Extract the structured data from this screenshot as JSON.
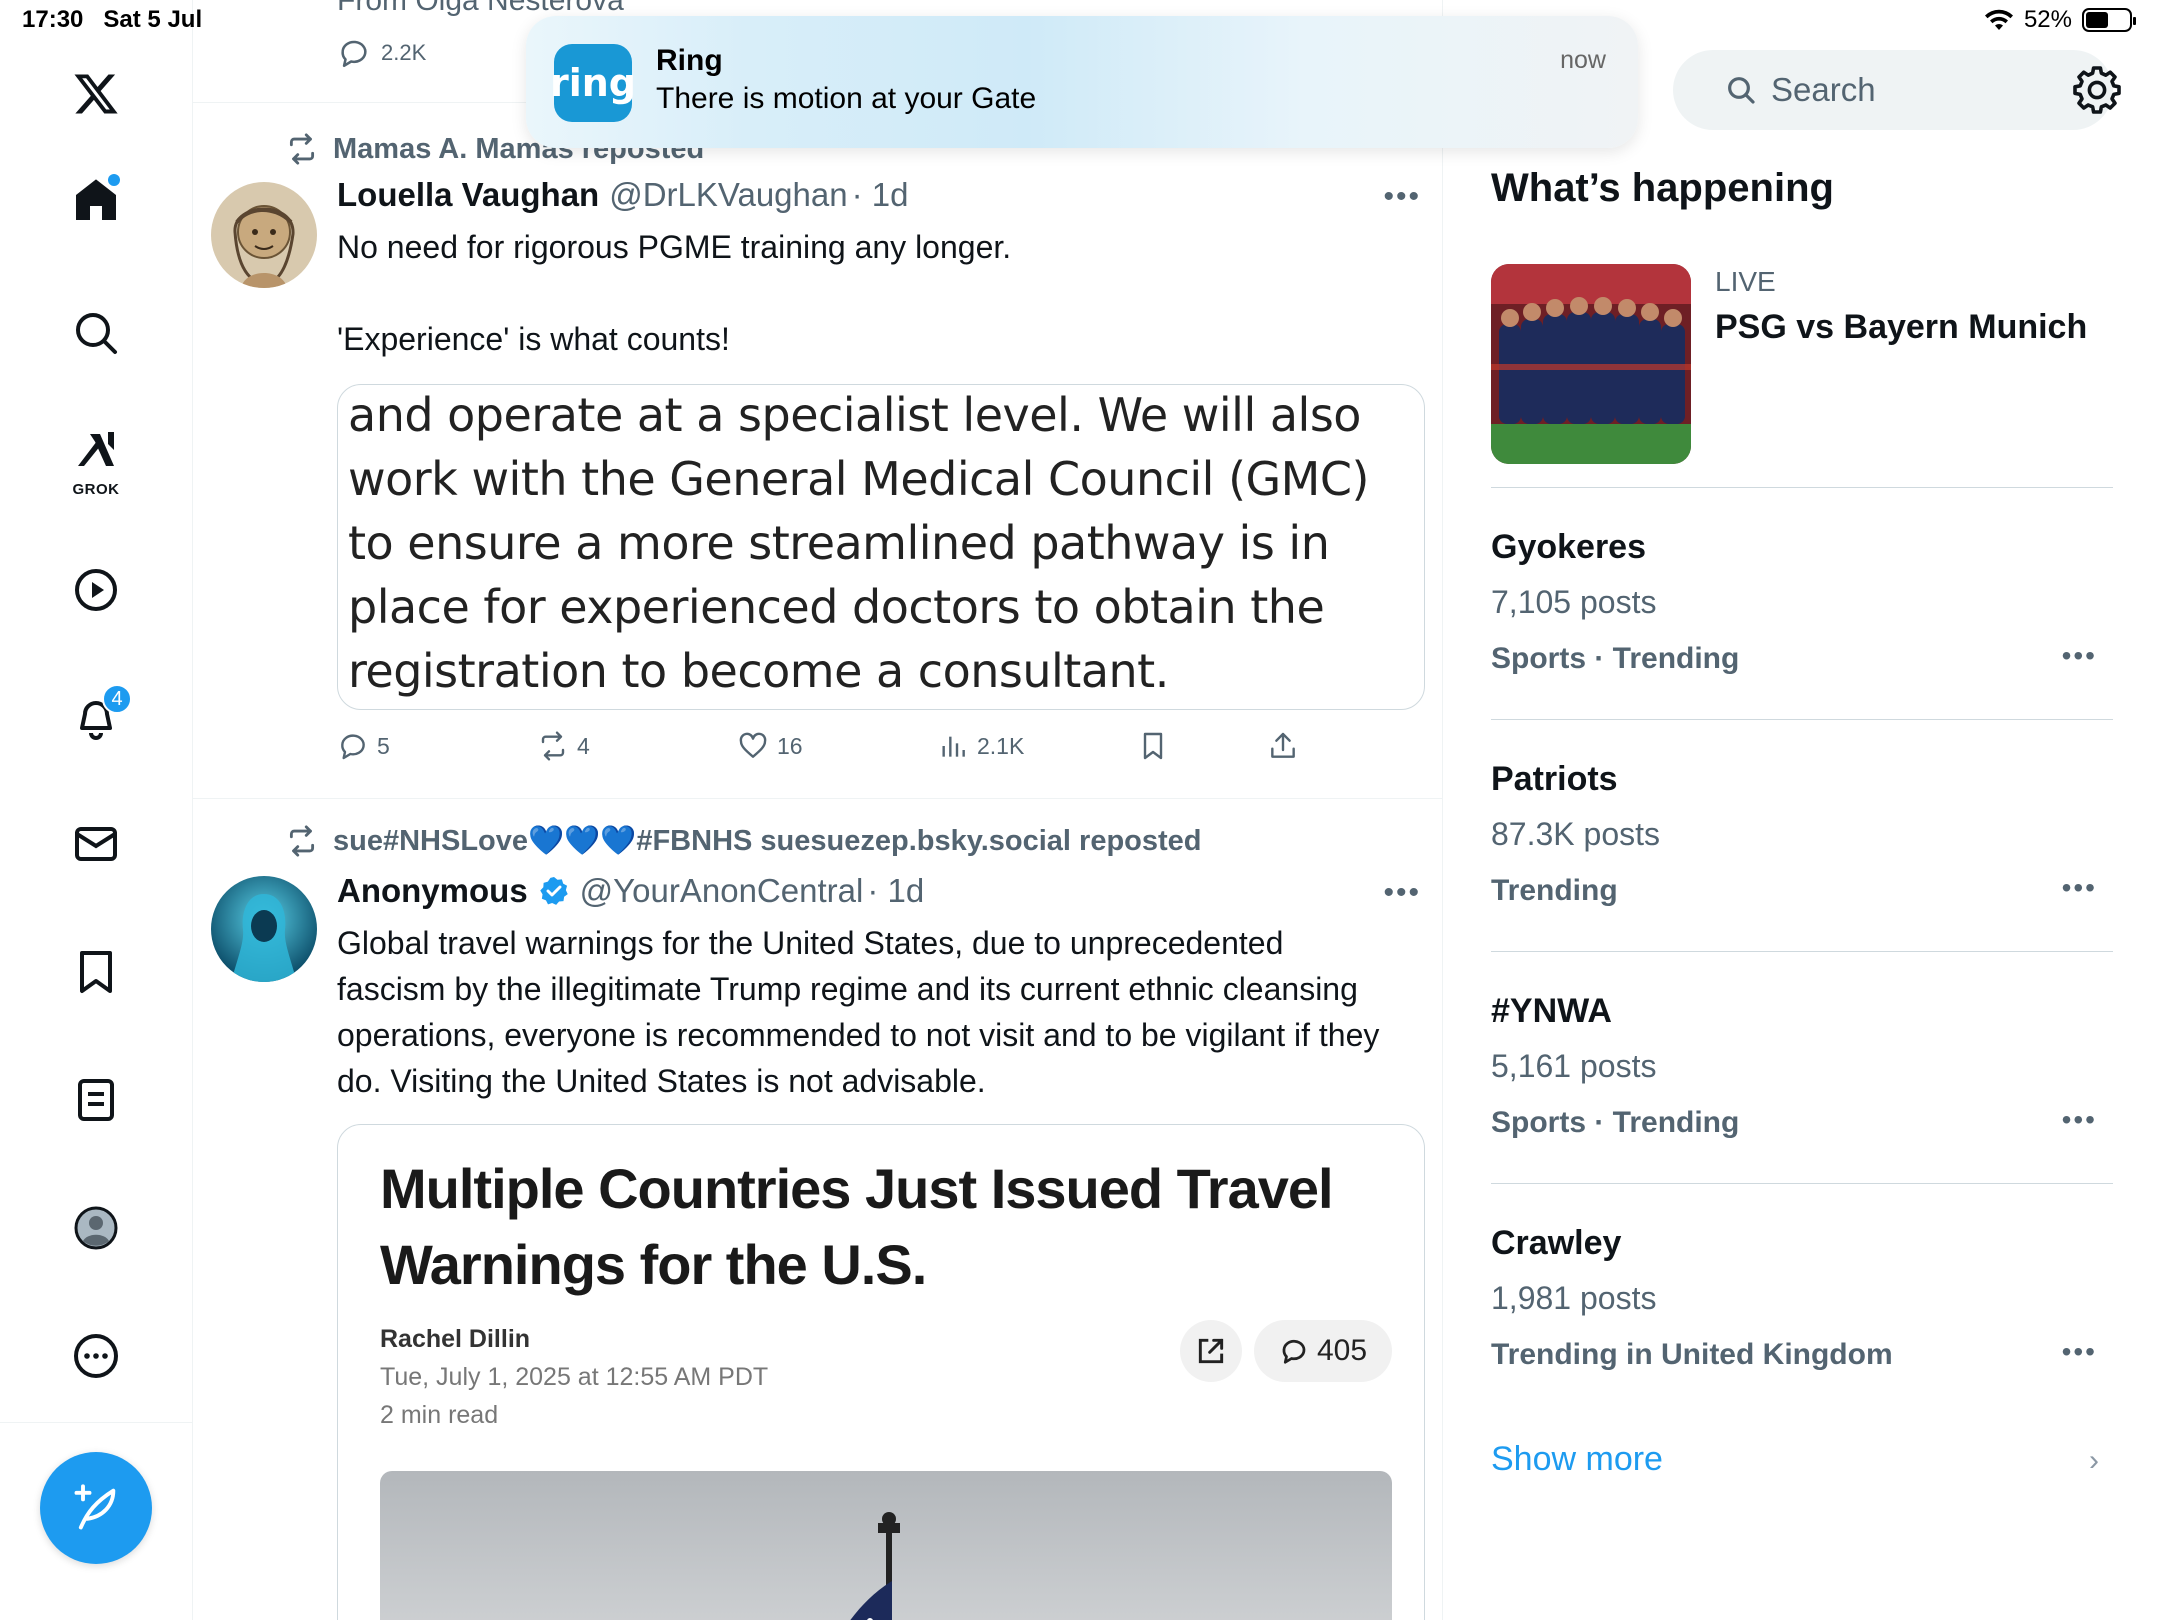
{
  "status_bar": {
    "time": "17:30",
    "date": "Sat 5 Jul",
    "battery": "52%",
    "battery_level": 0.52
  },
  "notification": {
    "app_name": "Ring",
    "icon_text": "ring",
    "message": "There is motion at your Gate",
    "time": "now"
  },
  "nav": {
    "grok_label": "GROK",
    "notifications_badge": "4",
    "items": [
      "x-logo",
      "home-icon",
      "search-icon",
      "grok-icon",
      "video-icon",
      "bell-icon",
      "mail-icon",
      "bookmark-icon",
      "lists-icon",
      "profile-icon",
      "more-icon"
    ]
  },
  "feed": {
    "top_partial": {
      "from_text": "From Olga Nesterova",
      "replies": "2.2K"
    },
    "posts": [
      {
        "reposted_by": "Mamas A. Mamas reposted",
        "name": "Louella Vaughan",
        "handle": "@DrLKVaughan",
        "time": "· 1d",
        "text": "No need for rigorous PGME training any longer.\n\n'Experience' is what counts!",
        "quote_image_text": "and operate at a specialist level. We will also work with the General Medical Council (GMC) to ensure a more streamlined pathway is in place for experienced doctors to obtain the registration to become a consultant.",
        "replies": "5",
        "reposts": "4",
        "likes": "16",
        "views": "2.1K"
      },
      {
        "reposted_by": "sue#NHSLove💙💙💙#FBNHS suesuezep.bsky.social reposted",
        "name": "Anonymous",
        "verified": true,
        "handle": "@YourAnonCentral",
        "time": "· 1d",
        "text": "Global travel warnings for the United States, due to unprecedented fascism by the illegitimate Trump regime and its current ethnic cleansing operations, everyone is recommended to not visit and to be vigilant if they do. Visiting the United States is not advisable.",
        "article": {
          "title": "Multiple Countries Just Issued Travel Warnings for the U.S.",
          "author": "Rachel Dillin",
          "date": "Tue, July 1, 2025 at 12:55 AM PDT",
          "read_time": "2 min read",
          "comments": "405"
        }
      }
    ]
  },
  "sidebar": {
    "search_placeholder": "Search",
    "heading": "What’s happening",
    "live": {
      "label": "LIVE",
      "title": "PSG vs Bayern Munich"
    },
    "trends": [
      {
        "title": "Gyokeres",
        "count": "7,105 posts",
        "category": "Sports · Trending"
      },
      {
        "title": "Patriots",
        "count": "87.3K posts",
        "category": "Trending"
      },
      {
        "title": "#YNWA",
        "count": "5,161 posts",
        "category": "Sports · Trending"
      },
      {
        "title": "Crawley",
        "count": "1,981 posts",
        "category": "Trending in United Kingdom"
      }
    ],
    "show_more": "Show more"
  },
  "colors": {
    "accent": "#1d9bf0",
    "text_primary": "#0f1419",
    "text_secondary": "#536471",
    "border": "#eff3f4"
  }
}
